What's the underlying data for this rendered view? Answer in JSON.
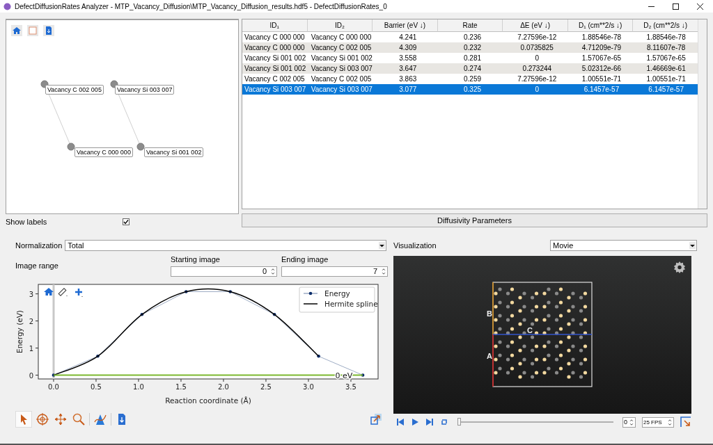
{
  "window": {
    "title": "DefectDiffusionRates Analyzer - MTP_Vacancy_Diffusion\\MTP_Vacancy_Diffusion_results.hdf5 - DefectDiffusionRates_0"
  },
  "graph": {
    "pairs": [
      {
        "nodes": [
          "Vacancy C 002 005",
          "Vacancy C 000 000"
        ]
      },
      {
        "nodes": [
          "Vacancy Si 003 007",
          "Vacancy Si 001 002"
        ]
      }
    ],
    "show_labels": {
      "label": "Show labels",
      "checked": true
    }
  },
  "table": {
    "columns": [
      "ID₁",
      "ID₂",
      "Barrier (eV ↓)",
      "Rate",
      "ΔE (eV ↓)",
      "D₁ (cm**2/s ↓)",
      "D₂ (cm**2/s ↓)"
    ],
    "rows": [
      {
        "cells": [
          "Vacancy C 000 000",
          "Vacancy C 000 000",
          "4.241",
          "0.236",
          "7.27596e-12",
          "1.88546e-78",
          "1.88546e-78"
        ],
        "selected": false
      },
      {
        "cells": [
          "Vacancy C 000 000",
          "Vacancy C 002 005",
          "4.309",
          "0.232",
          "0.0735825",
          "4.71209e-79",
          "8.11607e-78"
        ],
        "selected": false
      },
      {
        "cells": [
          "Vacancy Si 001 002",
          "Vacancy Si 001 002",
          "3.558",
          "0.281",
          "0",
          "1.57067e-65",
          "1.57067e-65"
        ],
        "selected": false
      },
      {
        "cells": [
          "Vacancy Si 001 002",
          "Vacancy Si 003 007",
          "3.647",
          "0.274",
          "0.273244",
          "5.02312e-66",
          "1.46669e-61"
        ],
        "selected": false
      },
      {
        "cells": [
          "Vacancy C 002 005",
          "Vacancy C 002 005",
          "3.863",
          "0.259",
          "7.27596e-12",
          "1.00551e-71",
          "1.00551e-71"
        ],
        "selected": false
      },
      {
        "cells": [
          "Vacancy Si 003 007",
          "Vacancy Si 003 007",
          "3.077",
          "0.325",
          "0",
          "6.1457e-57",
          "6.1457e-57"
        ],
        "selected": true
      }
    ]
  },
  "diffusivity_button": "Diffusivity Parameters",
  "normalization": {
    "label": "Normalization",
    "value": "Total"
  },
  "image_range": {
    "label": "Image range",
    "start": {
      "label": "Starting image",
      "value": "0"
    },
    "end": {
      "label": "Ending image",
      "value": "7"
    }
  },
  "energy_plot": {
    "chart_data": {
      "type": "line",
      "xlabel": "Reaction coordinate (Å)",
      "ylabel": "Energy (eV)",
      "x": [
        0,
        0.52,
        1.04,
        1.56,
        2.08,
        2.6,
        3.12,
        3.64
      ],
      "series": [
        {
          "name": "Energy",
          "color": "#0b2d6b",
          "values": [
            0,
            0.7,
            2.24,
            3.08,
            3.08,
            2.24,
            0.7,
            0
          ]
        },
        {
          "name": "Hermite spline",
          "color": "#000000",
          "values": [
            0,
            0.7,
            2.24,
            3.08,
            3.08,
            2.24,
            0.7,
            null
          ]
        },
        {
          "color": "#7cb82f",
          "values": [
            0,
            0,
            0,
            0,
            0,
            0,
            0,
            0
          ]
        }
      ],
      "annotations": [
        "0 eV"
      ],
      "legend": true,
      "xlim": [
        -0.18,
        3.82
      ],
      "ylim": [
        -0.14,
        3.35
      ],
      "xticks": [
        {
          "value": 0,
          "label": "0.0"
        },
        {
          "value": 0.5,
          "label": "0.5"
        },
        {
          "value": 1,
          "label": "1.0"
        },
        {
          "value": 1.5,
          "label": "1.5"
        },
        {
          "value": 2,
          "label": "2.0"
        },
        {
          "value": 2.5,
          "label": "2.5"
        },
        {
          "value": 3,
          "label": "3.0"
        },
        {
          "value": 3.5,
          "label": "3.5"
        }
      ],
      "yticks": [
        0,
        1,
        2,
        3
      ]
    }
  },
  "visualization": {
    "label": "Visualization",
    "value": "Movie",
    "axes": [
      "B",
      "C",
      "A"
    ],
    "frame": "0",
    "fps": "25 FPS",
    "slider": {
      "level": 0
    }
  }
}
